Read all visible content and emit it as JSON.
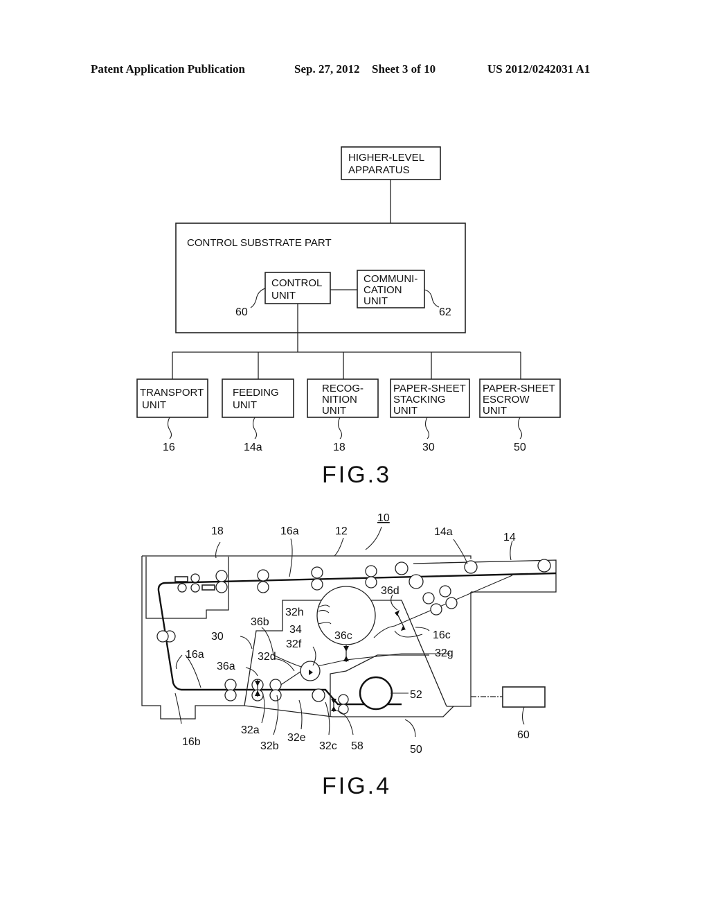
{
  "header": {
    "publication": "Patent Application Publication",
    "date": "Sep. 27, 2012",
    "sheet": "Sheet 3 of 10",
    "number": "US 2012/0242031 A1"
  },
  "fig3": {
    "caption": "FIG.3",
    "higher_level": [
      "HIGHER-LEVEL",
      "APPARATUS"
    ],
    "substrate_label": "CONTROL SUBSTRATE PART",
    "control_unit": [
      "CONTROL",
      "UNIT"
    ],
    "control_unit_ref": "60",
    "comm_unit": [
      "COMMUNI-",
      "CATION",
      "UNIT"
    ],
    "comm_unit_ref": "62",
    "units": [
      {
        "lines": [
          "TRANSPORT",
          "UNIT"
        ],
        "ref": "16"
      },
      {
        "lines": [
          "FEEDING",
          "UNIT"
        ],
        "ref": "14a"
      },
      {
        "lines": [
          "RECOG-",
          "NITION",
          "UNIT"
        ],
        "ref": "18"
      },
      {
        "lines": [
          "PAPER-SHEET",
          "STACKING",
          "UNIT"
        ],
        "ref": "30"
      },
      {
        "lines": [
          "PAPER-SHEET",
          "ESCROW",
          "UNIT"
        ],
        "ref": "50"
      }
    ]
  },
  "fig4": {
    "caption": "FIG.4",
    "labels": {
      "l10": "10",
      "l12": "12",
      "l14": "14",
      "l14a": "14a",
      "l16a_top": "16a",
      "l16a_left": "16a",
      "l16b": "16b",
      "l16c": "16c",
      "l18": "18",
      "l30": "30",
      "l32a": "32a",
      "l32b": "32b",
      "l32c": "32c",
      "l32d": "32d",
      "l32e": "32e",
      "l32f": "32f",
      "l32g": "32g",
      "l32h": "32h",
      "l34": "34",
      "l36a": "36a",
      "l36b": "36b",
      "l36c": "36c",
      "l36d": "36d",
      "l50": "50",
      "l52": "52",
      "l58": "58",
      "l60": "60"
    }
  }
}
